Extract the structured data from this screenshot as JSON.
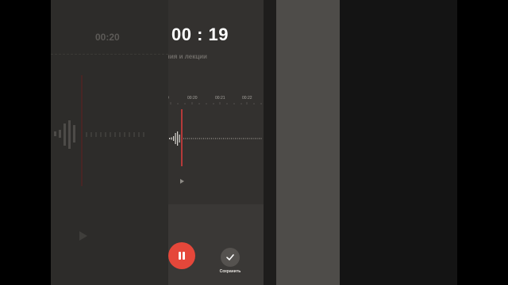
{
  "recorder": {
    "timer": "00 : 19",
    "subtitle": "ния и лекции",
    "timeline_ticks": [
      "9",
      "00:20",
      "00:21",
      "00:22"
    ],
    "save_label": "Сохранить",
    "colors": {
      "record_accent": "#e5473a",
      "playhead": "#b53a3a",
      "screen_bg": "#33312f"
    }
  },
  "backdrop": {
    "time_label": "00:20",
    "time_label_partial": "9"
  }
}
